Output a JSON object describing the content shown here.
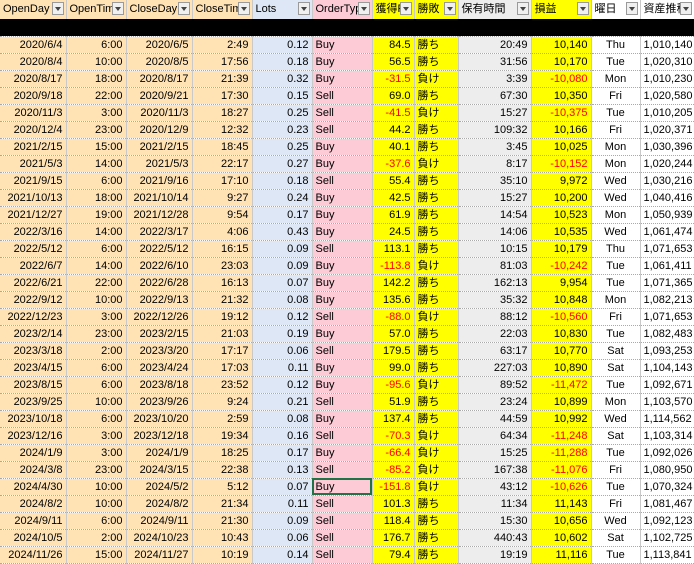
{
  "headers": [
    "OpenDay",
    "OpenTim",
    "CloseDay",
    "CloseTim",
    "Lots",
    "OrderTyp",
    "獲得P",
    "勝敗",
    "保有時間",
    "損益",
    "曜日",
    "資産推移"
  ],
  "colors": {
    "orange": "#ffe3b5",
    "blue": "#dde7f5",
    "pink": "#fccbd6",
    "yellow": "#ffff00",
    "grey": "#ededed",
    "negative": "#ff0000"
  },
  "rows": [
    {
      "openDay": "2020/6/4",
      "openTime": "6:00",
      "closeDay": "2020/6/5",
      "closeTime": "2:49",
      "lots": "0.12",
      "orderType": "Buy",
      "points": "84.5",
      "result": "勝ち",
      "holdTime": "20:49",
      "profit": "10,140",
      "weekday": "Thu",
      "balance": "1,010,140"
    },
    {
      "openDay": "2020/8/4",
      "openTime": "10:00",
      "closeDay": "2020/8/5",
      "closeTime": "17:56",
      "lots": "0.18",
      "orderType": "Buy",
      "points": "56.5",
      "result": "勝ち",
      "holdTime": "31:56",
      "profit": "10,170",
      "weekday": "Tue",
      "balance": "1,020,310"
    },
    {
      "openDay": "2020/8/17",
      "openTime": "18:00",
      "closeDay": "2020/8/17",
      "closeTime": "21:39",
      "lots": "0.32",
      "orderType": "Buy",
      "points": "-31.5",
      "result": "負け",
      "holdTime": "3:39",
      "profit": "-10,080",
      "weekday": "Mon",
      "balance": "1,010,230"
    },
    {
      "openDay": "2020/9/18",
      "openTime": "22:00",
      "closeDay": "2020/9/21",
      "closeTime": "17:30",
      "lots": "0.15",
      "orderType": "Sell",
      "points": "69.0",
      "result": "勝ち",
      "holdTime": "67:30",
      "profit": "10,350",
      "weekday": "Fri",
      "balance": "1,020,580"
    },
    {
      "openDay": "2020/11/3",
      "openTime": "3:00",
      "closeDay": "2020/11/3",
      "closeTime": "18:27",
      "lots": "0.25",
      "orderType": "Sell",
      "points": "-41.5",
      "result": "負け",
      "holdTime": "15:27",
      "profit": "-10,375",
      "weekday": "Tue",
      "balance": "1,010,205"
    },
    {
      "openDay": "2020/12/4",
      "openTime": "23:00",
      "closeDay": "2020/12/9",
      "closeTime": "12:32",
      "lots": "0.23",
      "orderType": "Sell",
      "points": "44.2",
      "result": "勝ち",
      "holdTime": "109:32",
      "profit": "10,166",
      "weekday": "Fri",
      "balance": "1,020,371"
    },
    {
      "openDay": "2021/2/15",
      "openTime": "15:00",
      "closeDay": "2021/2/15",
      "closeTime": "18:45",
      "lots": "0.25",
      "orderType": "Buy",
      "points": "40.1",
      "result": "勝ち",
      "holdTime": "3:45",
      "profit": "10,025",
      "weekday": "Mon",
      "balance": "1,030,396"
    },
    {
      "openDay": "2021/5/3",
      "openTime": "14:00",
      "closeDay": "2021/5/3",
      "closeTime": "22:17",
      "lots": "0.27",
      "orderType": "Buy",
      "points": "-37.6",
      "result": "負け",
      "holdTime": "8:17",
      "profit": "-10,152",
      "weekday": "Mon",
      "balance": "1,020,244"
    },
    {
      "openDay": "2021/9/15",
      "openTime": "6:00",
      "closeDay": "2021/9/16",
      "closeTime": "17:10",
      "lots": "0.18",
      "orderType": "Sell",
      "points": "55.4",
      "result": "勝ち",
      "holdTime": "35:10",
      "profit": "9,972",
      "weekday": "Wed",
      "balance": "1,030,216"
    },
    {
      "openDay": "2021/10/13",
      "openTime": "18:00",
      "closeDay": "2021/10/14",
      "closeTime": "9:27",
      "lots": "0.24",
      "orderType": "Buy",
      "points": "42.5",
      "result": "勝ち",
      "holdTime": "15:27",
      "profit": "10,200",
      "weekday": "Wed",
      "balance": "1,040,416"
    },
    {
      "openDay": "2021/12/27",
      "openTime": "19:00",
      "closeDay": "2021/12/28",
      "closeTime": "9:54",
      "lots": "0.17",
      "orderType": "Buy",
      "points": "61.9",
      "result": "勝ち",
      "holdTime": "14:54",
      "profit": "10,523",
      "weekday": "Mon",
      "balance": "1,050,939"
    },
    {
      "openDay": "2022/3/16",
      "openTime": "14:00",
      "closeDay": "2022/3/17",
      "closeTime": "4:06",
      "lots": "0.43",
      "orderType": "Buy",
      "points": "24.5",
      "result": "勝ち",
      "holdTime": "14:06",
      "profit": "10,535",
      "weekday": "Wed",
      "balance": "1,061,474"
    },
    {
      "openDay": "2022/5/12",
      "openTime": "6:00",
      "closeDay": "2022/5/12",
      "closeTime": "16:15",
      "lots": "0.09",
      "orderType": "Sell",
      "points": "113.1",
      "result": "勝ち",
      "holdTime": "10:15",
      "profit": "10,179",
      "weekday": "Thu",
      "balance": "1,071,653"
    },
    {
      "openDay": "2022/6/7",
      "openTime": "14:00",
      "closeDay": "2022/6/10",
      "closeTime": "23:03",
      "lots": "0.09",
      "orderType": "Buy",
      "points": "-113.8",
      "result": "負け",
      "holdTime": "81:03",
      "profit": "-10,242",
      "weekday": "Tue",
      "balance": "1,061,411"
    },
    {
      "openDay": "2022/6/21",
      "openTime": "22:00",
      "closeDay": "2022/6/28",
      "closeTime": "16:13",
      "lots": "0.07",
      "orderType": "Buy",
      "points": "142.2",
      "result": "勝ち",
      "holdTime": "162:13",
      "profit": "9,954",
      "weekday": "Tue",
      "balance": "1,071,365"
    },
    {
      "openDay": "2022/9/12",
      "openTime": "10:00",
      "closeDay": "2022/9/13",
      "closeTime": "21:32",
      "lots": "0.08",
      "orderType": "Buy",
      "points": "135.6",
      "result": "勝ち",
      "holdTime": "35:32",
      "profit": "10,848",
      "weekday": "Mon",
      "balance": "1,082,213"
    },
    {
      "openDay": "2022/12/23",
      "openTime": "3:00",
      "closeDay": "2022/12/26",
      "closeTime": "19:12",
      "lots": "0.12",
      "orderType": "Sell",
      "points": "-88.0",
      "result": "負け",
      "holdTime": "88:12",
      "profit": "-10,560",
      "weekday": "Fri",
      "balance": "1,071,653"
    },
    {
      "openDay": "2023/2/14",
      "openTime": "23:00",
      "closeDay": "2023/2/15",
      "closeTime": "21:03",
      "lots": "0.19",
      "orderType": "Buy",
      "points": "57.0",
      "result": "勝ち",
      "holdTime": "22:03",
      "profit": "10,830",
      "weekday": "Tue",
      "balance": "1,082,483"
    },
    {
      "openDay": "2023/3/18",
      "openTime": "2:00",
      "closeDay": "2023/3/20",
      "closeTime": "17:17",
      "lots": "0.06",
      "orderType": "Sell",
      "points": "179.5",
      "result": "勝ち",
      "holdTime": "63:17",
      "profit": "10,770",
      "weekday": "Sat",
      "balance": "1,093,253"
    },
    {
      "openDay": "2023/4/15",
      "openTime": "6:00",
      "closeDay": "2023/4/24",
      "closeTime": "17:03",
      "lots": "0.11",
      "orderType": "Buy",
      "points": "99.0",
      "result": "勝ち",
      "holdTime": "227:03",
      "profit": "10,890",
      "weekday": "Sat",
      "balance": "1,104,143"
    },
    {
      "openDay": "2023/8/15",
      "openTime": "6:00",
      "closeDay": "2023/8/18",
      "closeTime": "23:52",
      "lots": "0.12",
      "orderType": "Buy",
      "points": "-95.6",
      "result": "負け",
      "holdTime": "89:52",
      "profit": "-11,472",
      "weekday": "Tue",
      "balance": "1,092,671"
    },
    {
      "openDay": "2023/9/25",
      "openTime": "10:00",
      "closeDay": "2023/9/26",
      "closeTime": "9:24",
      "lots": "0.21",
      "orderType": "Sell",
      "points": "51.9",
      "result": "勝ち",
      "holdTime": "23:24",
      "profit": "10,899",
      "weekday": "Mon",
      "balance": "1,103,570"
    },
    {
      "openDay": "2023/10/18",
      "openTime": "6:00",
      "closeDay": "2023/10/20",
      "closeTime": "2:59",
      "lots": "0.08",
      "orderType": "Buy",
      "points": "137.4",
      "result": "勝ち",
      "holdTime": "44:59",
      "profit": "10,992",
      "weekday": "Wed",
      "balance": "1,114,562"
    },
    {
      "openDay": "2023/12/16",
      "openTime": "3:00",
      "closeDay": "2023/12/18",
      "closeTime": "19:34",
      "lots": "0.16",
      "orderType": "Sell",
      "points": "-70.3",
      "result": "負け",
      "holdTime": "64:34",
      "profit": "-11,248",
      "weekday": "Sat",
      "balance": "1,103,314"
    },
    {
      "openDay": "2024/1/9",
      "openTime": "3:00",
      "closeDay": "2024/1/9",
      "closeTime": "18:25",
      "lots": "0.17",
      "orderType": "Buy",
      "points": "-66.4",
      "result": "負け",
      "holdTime": "15:25",
      "profit": "-11,288",
      "weekday": "Tue",
      "balance": "1,092,026"
    },
    {
      "openDay": "2024/3/8",
      "openTime": "23:00",
      "closeDay": "2024/3/15",
      "closeTime": "22:38",
      "lots": "0.13",
      "orderType": "Sell",
      "points": "-85.2",
      "result": "負け",
      "holdTime": "167:38",
      "profit": "-11,076",
      "weekday": "Fri",
      "balance": "1,080,950"
    },
    {
      "openDay": "2024/4/30",
      "openTime": "10:00",
      "closeDay": "2024/5/2",
      "closeTime": "5:12",
      "lots": "0.07",
      "orderType": "Buy",
      "points": "-151.8",
      "result": "負け",
      "holdTime": "43:12",
      "profit": "-10,626",
      "weekday": "Tue",
      "balance": "1,070,324"
    },
    {
      "openDay": "2024/8/2",
      "openTime": "10:00",
      "closeDay": "2024/8/2",
      "closeTime": "21:34",
      "lots": "0.11",
      "orderType": "Sell",
      "points": "101.3",
      "result": "勝ち",
      "holdTime": "11:34",
      "profit": "11,143",
      "weekday": "Fri",
      "balance": "1,081,467"
    },
    {
      "openDay": "2024/9/11",
      "openTime": "6:00",
      "closeDay": "2024/9/11",
      "closeTime": "21:30",
      "lots": "0.09",
      "orderType": "Sell",
      "points": "118.4",
      "result": "勝ち",
      "holdTime": "15:30",
      "profit": "10,656",
      "weekday": "Wed",
      "balance": "1,092,123"
    },
    {
      "openDay": "2024/10/5",
      "openTime": "2:00",
      "closeDay": "2024/10/23",
      "closeTime": "10:43",
      "lots": "0.06",
      "orderType": "Sell",
      "points": "176.7",
      "result": "勝ち",
      "holdTime": "440:43",
      "profit": "10,602",
      "weekday": "Sat",
      "balance": "1,102,725"
    },
    {
      "openDay": "2024/11/26",
      "openTime": "15:00",
      "closeDay": "2024/11/27",
      "closeTime": "10:19",
      "lots": "0.14",
      "orderType": "Sell",
      "points": "79.4",
      "result": "勝ち",
      "holdTime": "19:19",
      "profit": "11,116",
      "weekday": "Tue",
      "balance": "1,113,841"
    }
  ]
}
